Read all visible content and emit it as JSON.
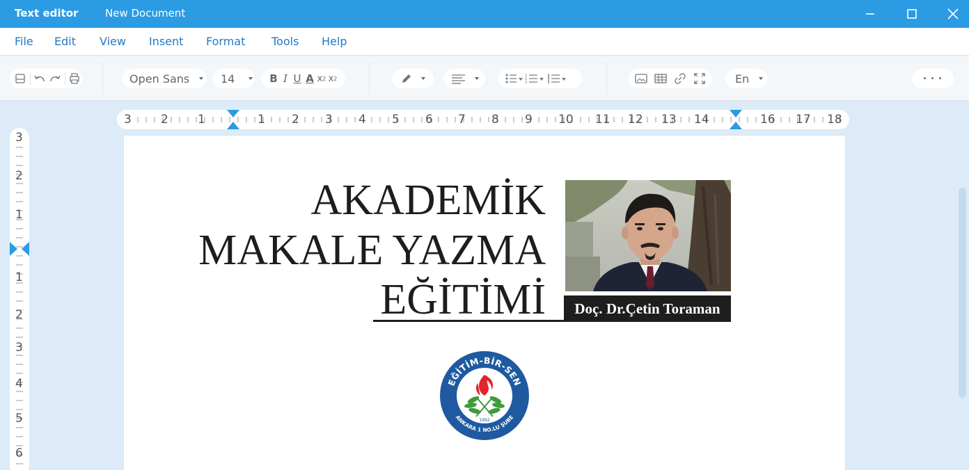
{
  "titlebar": {
    "app_name": "Text editor",
    "document_name": "New Document"
  },
  "menu": {
    "file": "File",
    "edit": "Edit",
    "view": "View",
    "insert": "Insent",
    "format": "Format",
    "tools": "Tools",
    "help": "Help"
  },
  "toolbar": {
    "font_family": "Open Sans",
    "font_size": "14",
    "language": "En",
    "more": "• • •"
  },
  "ruler": {
    "horizontal": [
      "3",
      "2",
      "1",
      "1",
      "2",
      "3",
      "4",
      "5",
      "6",
      "7",
      "8",
      "9",
      "10",
      "11",
      "12",
      "13",
      "14",
      "16",
      "17",
      "18"
    ],
    "vertical": [
      "3",
      "2",
      "1",
      "1",
      "2",
      "3",
      "4",
      "5",
      "6"
    ]
  },
  "document": {
    "title_line1": "AKADEMİK",
    "title_line2": "MAKALE YAZMA",
    "title_line3": "EĞİTİMİ",
    "photo_caption": "Doç. Dr.Çetin Toraman",
    "logo": {
      "top_text": "EĞİTİM-BİR-SEN",
      "bottom_text": "ANKARA 1 NO.LU ŞUBE",
      "year": "1992"
    }
  },
  "colors": {
    "accent": "#2b9be3",
    "menu_text": "#2479c4",
    "background": "#dcebf7",
    "logo_blue": "#1f5aa0",
    "logo_red": "#e0262b",
    "logo_green": "#3f9b3a"
  }
}
